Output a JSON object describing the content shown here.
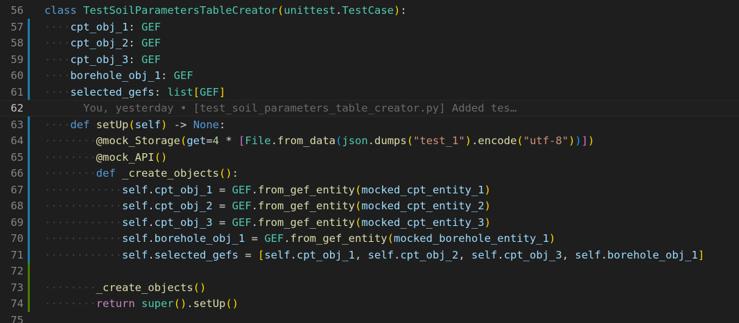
{
  "editor": {
    "accent_colors": {
      "modified_gutter": "#1b81a8",
      "added_gutter": "#487e02"
    },
    "lines": [
      {
        "number": "56",
        "gutter": "none",
        "current": false,
        "tokens": [
          {
            "t": "class",
            "c": "kw"
          },
          {
            "t": " ",
            "c": "op"
          },
          {
            "t": "TestSoilParametersTableCreator",
            "c": "cls"
          },
          {
            "t": "(",
            "c": "br1"
          },
          {
            "t": "unittest",
            "c": "cls"
          },
          {
            "t": ".",
            "c": "op"
          },
          {
            "t": "TestCase",
            "c": "cls"
          },
          {
            "t": ")",
            "c": "br1"
          },
          {
            "t": ":",
            "c": "op"
          }
        ]
      },
      {
        "number": "57",
        "gutter": "modified",
        "current": false,
        "tokens": [
          {
            "t": "····",
            "c": "dot"
          },
          {
            "t": "cpt_obj_1",
            "c": "var"
          },
          {
            "t": ": ",
            "c": "op"
          },
          {
            "t": "GEF",
            "c": "cls"
          }
        ]
      },
      {
        "number": "58",
        "gutter": "modified",
        "current": false,
        "tokens": [
          {
            "t": "····",
            "c": "dot"
          },
          {
            "t": "cpt_obj_2",
            "c": "var"
          },
          {
            "t": ": ",
            "c": "op"
          },
          {
            "t": "GEF",
            "c": "cls"
          }
        ]
      },
      {
        "number": "59",
        "gutter": "modified",
        "current": false,
        "tokens": [
          {
            "t": "····",
            "c": "dot"
          },
          {
            "t": "cpt_obj_3",
            "c": "var"
          },
          {
            "t": ": ",
            "c": "op"
          },
          {
            "t": "GEF",
            "c": "cls"
          }
        ]
      },
      {
        "number": "60",
        "gutter": "modified",
        "current": false,
        "tokens": [
          {
            "t": "····",
            "c": "dot"
          },
          {
            "t": "borehole_obj_1",
            "c": "var"
          },
          {
            "t": ": ",
            "c": "op"
          },
          {
            "t": "GEF",
            "c": "cls"
          }
        ]
      },
      {
        "number": "61",
        "gutter": "modified",
        "current": false,
        "tokens": [
          {
            "t": "····",
            "c": "dot"
          },
          {
            "t": "selected_gefs",
            "c": "var"
          },
          {
            "t": ": ",
            "c": "op"
          },
          {
            "t": "list",
            "c": "cls"
          },
          {
            "t": "[",
            "c": "br1"
          },
          {
            "t": "GEF",
            "c": "cls"
          },
          {
            "t": "]",
            "c": "br1"
          }
        ]
      },
      {
        "number": "62",
        "gutter": "none",
        "current": true,
        "tokens": [
          {
            "t": "      You, yesterday • [test_soil_parameters_table_creator.py] Added tes…",
            "c": "blame"
          }
        ]
      },
      {
        "number": "63",
        "gutter": "modified",
        "current": false,
        "tokens": [
          {
            "t": "····",
            "c": "dot"
          },
          {
            "t": "def",
            "c": "kw"
          },
          {
            "t": " ",
            "c": "op"
          },
          {
            "t": "setUp",
            "c": "fn"
          },
          {
            "t": "(",
            "c": "br1"
          },
          {
            "t": "self",
            "c": "var"
          },
          {
            "t": ")",
            "c": "br1"
          },
          {
            "t": " -> ",
            "c": "op"
          },
          {
            "t": "None",
            "c": "kw"
          },
          {
            "t": ":",
            "c": "op"
          }
        ]
      },
      {
        "number": "64",
        "gutter": "modified",
        "current": false,
        "tokens": [
          {
            "t": "····",
            "c": "dot"
          },
          {
            "t": "····",
            "c": "dot"
          },
          {
            "t": "@mock_Storage",
            "c": "fn"
          },
          {
            "t": "(",
            "c": "br1"
          },
          {
            "t": "get",
            "c": "var"
          },
          {
            "t": "=",
            "c": "op"
          },
          {
            "t": "4",
            "c": "num"
          },
          {
            "t": " * ",
            "c": "op"
          },
          {
            "t": "[",
            "c": "br2"
          },
          {
            "t": "File",
            "c": "cls"
          },
          {
            "t": ".",
            "c": "op"
          },
          {
            "t": "from_data",
            "c": "fn"
          },
          {
            "t": "(",
            "c": "br3"
          },
          {
            "t": "json",
            "c": "cls"
          },
          {
            "t": ".",
            "c": "op"
          },
          {
            "t": "dumps",
            "c": "fn"
          },
          {
            "t": "(",
            "c": "br1"
          },
          {
            "t": "\"test_1\"",
            "c": "str"
          },
          {
            "t": ")",
            "c": "br1"
          },
          {
            "t": ".",
            "c": "op"
          },
          {
            "t": "encode",
            "c": "fn"
          },
          {
            "t": "(",
            "c": "br1"
          },
          {
            "t": "\"utf-8\"",
            "c": "str"
          },
          {
            "t": ")",
            "c": "br1"
          },
          {
            "t": ")",
            "c": "br3"
          },
          {
            "t": "]",
            "c": "br2"
          },
          {
            "t": ")",
            "c": "br1"
          }
        ]
      },
      {
        "number": "65",
        "gutter": "modified",
        "current": false,
        "tokens": [
          {
            "t": "····",
            "c": "dot"
          },
          {
            "t": "····",
            "c": "dot"
          },
          {
            "t": "@mock_API",
            "c": "fn"
          },
          {
            "t": "(",
            "c": "br1"
          },
          {
            "t": ")",
            "c": "br1"
          }
        ]
      },
      {
        "number": "66",
        "gutter": "modified",
        "current": false,
        "tokens": [
          {
            "t": "····",
            "c": "dot"
          },
          {
            "t": "····",
            "c": "dot"
          },
          {
            "t": "def",
            "c": "kw"
          },
          {
            "t": " ",
            "c": "op"
          },
          {
            "t": "_create_objects",
            "c": "fn"
          },
          {
            "t": "(",
            "c": "br1"
          },
          {
            "t": ")",
            "c": "br1"
          },
          {
            "t": ":",
            "c": "op"
          }
        ]
      },
      {
        "number": "67",
        "gutter": "modified",
        "current": false,
        "tokens": [
          {
            "t": "····",
            "c": "dot"
          },
          {
            "t": "····",
            "c": "dot"
          },
          {
            "t": "····",
            "c": "dot"
          },
          {
            "t": "self",
            "c": "var"
          },
          {
            "t": ".",
            "c": "op"
          },
          {
            "t": "cpt_obj_1",
            "c": "var"
          },
          {
            "t": " = ",
            "c": "op"
          },
          {
            "t": "GEF",
            "c": "cls"
          },
          {
            "t": ".",
            "c": "op"
          },
          {
            "t": "from_gef_entity",
            "c": "fn"
          },
          {
            "t": "(",
            "c": "br1"
          },
          {
            "t": "mocked_cpt_entity_1",
            "c": "var"
          },
          {
            "t": ")",
            "c": "br1"
          }
        ]
      },
      {
        "number": "68",
        "gutter": "modified",
        "current": false,
        "tokens": [
          {
            "t": "····",
            "c": "dot"
          },
          {
            "t": "····",
            "c": "dot"
          },
          {
            "t": "····",
            "c": "dot"
          },
          {
            "t": "self",
            "c": "var"
          },
          {
            "t": ".",
            "c": "op"
          },
          {
            "t": "cpt_obj_2",
            "c": "var"
          },
          {
            "t": " = ",
            "c": "op"
          },
          {
            "t": "GEF",
            "c": "cls"
          },
          {
            "t": ".",
            "c": "op"
          },
          {
            "t": "from_gef_entity",
            "c": "fn"
          },
          {
            "t": "(",
            "c": "br1"
          },
          {
            "t": "mocked_cpt_entity_2",
            "c": "var"
          },
          {
            "t": ")",
            "c": "br1"
          }
        ]
      },
      {
        "number": "69",
        "gutter": "modified",
        "current": false,
        "tokens": [
          {
            "t": "····",
            "c": "dot"
          },
          {
            "t": "····",
            "c": "dot"
          },
          {
            "t": "····",
            "c": "dot"
          },
          {
            "t": "self",
            "c": "var"
          },
          {
            "t": ".",
            "c": "op"
          },
          {
            "t": "cpt_obj_3",
            "c": "var"
          },
          {
            "t": " = ",
            "c": "op"
          },
          {
            "t": "GEF",
            "c": "cls"
          },
          {
            "t": ".",
            "c": "op"
          },
          {
            "t": "from_gef_entity",
            "c": "fn"
          },
          {
            "t": "(",
            "c": "br1"
          },
          {
            "t": "mocked_cpt_entity_3",
            "c": "var"
          },
          {
            "t": ")",
            "c": "br1"
          }
        ]
      },
      {
        "number": "70",
        "gutter": "modified",
        "current": false,
        "tokens": [
          {
            "t": "····",
            "c": "dot"
          },
          {
            "t": "····",
            "c": "dot"
          },
          {
            "t": "····",
            "c": "dot"
          },
          {
            "t": "self",
            "c": "var"
          },
          {
            "t": ".",
            "c": "op"
          },
          {
            "t": "borehole_obj_1",
            "c": "var"
          },
          {
            "t": " = ",
            "c": "op"
          },
          {
            "t": "GEF",
            "c": "cls"
          },
          {
            "t": ".",
            "c": "op"
          },
          {
            "t": "from_gef_entity",
            "c": "fn"
          },
          {
            "t": "(",
            "c": "br1"
          },
          {
            "t": "mocked_borehole_entity_1",
            "c": "var"
          },
          {
            "t": ")",
            "c": "br1"
          }
        ]
      },
      {
        "number": "71",
        "gutter": "modified",
        "current": false,
        "tokens": [
          {
            "t": "····",
            "c": "dot"
          },
          {
            "t": "····",
            "c": "dot"
          },
          {
            "t": "····",
            "c": "dot"
          },
          {
            "t": "self",
            "c": "var"
          },
          {
            "t": ".",
            "c": "op"
          },
          {
            "t": "selected_gefs",
            "c": "var"
          },
          {
            "t": " = ",
            "c": "op"
          },
          {
            "t": "[",
            "c": "br1"
          },
          {
            "t": "self",
            "c": "var"
          },
          {
            "t": ".",
            "c": "op"
          },
          {
            "t": "cpt_obj_1",
            "c": "var"
          },
          {
            "t": ", ",
            "c": "op"
          },
          {
            "t": "self",
            "c": "var"
          },
          {
            "t": ".",
            "c": "op"
          },
          {
            "t": "cpt_obj_2",
            "c": "var"
          },
          {
            "t": ", ",
            "c": "op"
          },
          {
            "t": "self",
            "c": "var"
          },
          {
            "t": ".",
            "c": "op"
          },
          {
            "t": "cpt_obj_3",
            "c": "var"
          },
          {
            "t": ", ",
            "c": "op"
          },
          {
            "t": "self",
            "c": "var"
          },
          {
            "t": ".",
            "c": "op"
          },
          {
            "t": "borehole_obj_1",
            "c": "var"
          },
          {
            "t": "]",
            "c": "br1"
          }
        ]
      },
      {
        "number": "72",
        "gutter": "added",
        "current": false,
        "tokens": []
      },
      {
        "number": "73",
        "gutter": "added",
        "current": false,
        "tokens": [
          {
            "t": "······",
            "c": "dot"
          },
          {
            "t": "··",
            "c": "dot"
          },
          {
            "t": "_create_objects",
            "c": "fn"
          },
          {
            "t": "(",
            "c": "br1"
          },
          {
            "t": ")",
            "c": "br1"
          }
        ]
      },
      {
        "number": "74",
        "gutter": "added",
        "current": false,
        "tokens": [
          {
            "t": "····",
            "c": "dot"
          },
          {
            "t": "····",
            "c": "dot"
          },
          {
            "t": "return",
            "c": "ctrl"
          },
          {
            "t": " ",
            "c": "op"
          },
          {
            "t": "super",
            "c": "cls"
          },
          {
            "t": "(",
            "c": "br1"
          },
          {
            "t": ")",
            "c": "br1"
          },
          {
            "t": ".",
            "c": "op"
          },
          {
            "t": "setUp",
            "c": "fn"
          },
          {
            "t": "(",
            "c": "br1"
          },
          {
            "t": ")",
            "c": "br1"
          }
        ]
      },
      {
        "number": "75",
        "gutter": "none",
        "current": false,
        "tokens": []
      }
    ]
  }
}
